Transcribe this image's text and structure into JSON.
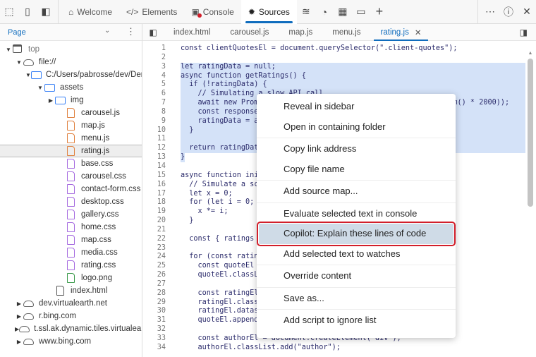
{
  "topbar": {
    "tabs": [
      {
        "label": "Welcome",
        "icon": "home-icon"
      },
      {
        "label": "Elements",
        "icon": "code-icon"
      },
      {
        "label": "Console",
        "icon": "console-icon"
      },
      {
        "label": "Sources",
        "icon": "bug-icon"
      }
    ],
    "active": "Sources",
    "console_badge_color": "#d21f2b"
  },
  "sidebar": {
    "selector": "Page",
    "tree": [
      {
        "label": "top",
        "depth": 0,
        "arrow": "down",
        "icon": "window"
      },
      {
        "label": "file://",
        "depth": 1,
        "arrow": "down",
        "icon": "cloud"
      },
      {
        "label": "C:/Users/pabrosse/dev/Demos",
        "depth": 2,
        "arrow": "down",
        "icon": "folder"
      },
      {
        "label": "assets",
        "depth": 3,
        "arrow": "down",
        "icon": "folder"
      },
      {
        "label": "img",
        "depth": 4,
        "arrow": "right",
        "icon": "folder"
      },
      {
        "label": "carousel.js",
        "depth": 5,
        "icon": "js"
      },
      {
        "label": "map.js",
        "depth": 5,
        "icon": "js"
      },
      {
        "label": "menu.js",
        "depth": 5,
        "icon": "js"
      },
      {
        "label": "rating.js",
        "depth": 5,
        "icon": "js",
        "selected": true
      },
      {
        "label": "base.css",
        "depth": 5,
        "icon": "css"
      },
      {
        "label": "carousel.css",
        "depth": 5,
        "icon": "css"
      },
      {
        "label": "contact-form.css",
        "depth": 5,
        "icon": "css"
      },
      {
        "label": "desktop.css",
        "depth": 5,
        "icon": "css"
      },
      {
        "label": "gallery.css",
        "depth": 5,
        "icon": "css"
      },
      {
        "label": "home.css",
        "depth": 5,
        "icon": "css"
      },
      {
        "label": "map.css",
        "depth": 5,
        "icon": "css"
      },
      {
        "label": "media.css",
        "depth": 5,
        "icon": "css"
      },
      {
        "label": "rating.css",
        "depth": 5,
        "icon": "css"
      },
      {
        "label": "logo.png",
        "depth": 5,
        "icon": "img"
      },
      {
        "label": "index.html",
        "depth": 4,
        "icon": "html"
      },
      {
        "label": "dev.virtualearth.net",
        "depth": 1,
        "arrow": "right",
        "icon": "cloud"
      },
      {
        "label": "r.bing.com",
        "depth": 1,
        "arrow": "right",
        "icon": "cloud"
      },
      {
        "label": "t.ssl.ak.dynamic.tiles.virtualearth.net",
        "depth": 1,
        "arrow": "right",
        "icon": "cloud"
      },
      {
        "label": "www.bing.com",
        "depth": 1,
        "arrow": "right",
        "icon": "cloud"
      }
    ]
  },
  "editor": {
    "tabs": [
      "index.html",
      "carousel.js",
      "map.js",
      "menu.js",
      "rating.js"
    ],
    "active": "rating.js",
    "selection": {
      "from": 3,
      "to": 13
    },
    "lines": [
      "const clientQuotesEl = document.querySelector(\".client-quotes\");",
      "",
      "let ratingData = null;",
      "async function getRatings() {",
      "  if (!ratingData) {",
      "    // Simulating a slow API call",
      "    await new Promise(resolve => setTimeout(resolve, Math.random() * 2000));",
      "    const response",
      "    ratingData = aw",
      "  }",
      "",
      "  return ratingData",
      "}",
      "",
      "async function init",
      "  // Simulate a sc",
      "  let x = 0;",
      "  for (let i = 0; i",
      "    x *= i;",
      "  }",
      "",
      "  const { ratings }",
      "",
      "  for (const rating",
      "    const quoteEl =",
      "    quoteEl.classLi",
      "",
      "    const ratingEl",
      "    ratingEl.classL",
      "    ratingEl.datase",
      "    quoteEl.appendC",
      "",
      "    const authorEl = document.createElement(\"div\");",
      "    authorEl.classList.add(\"author\");"
    ]
  },
  "context_menu": {
    "groups": [
      [
        "Reveal in sidebar",
        "Open in containing folder"
      ],
      [
        "Copy link address",
        "Copy file name"
      ],
      [
        "Add source map..."
      ],
      [
        "Evaluate selected text in console",
        "Copilot: Explain these lines of code",
        "Add selected text to watches"
      ],
      [
        "Override content"
      ],
      [
        "Save as..."
      ],
      [
        "Add script to ignore list"
      ]
    ],
    "highlighted": "Copilot: Explain these lines of code"
  }
}
